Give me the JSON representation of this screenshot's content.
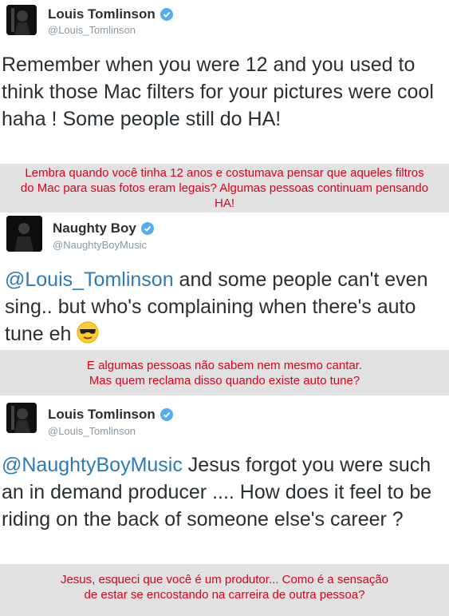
{
  "tweet1": {
    "name": "Louis Tomlinson",
    "handle": "@Louis_Tomlinson",
    "text": "Remember when you were 12 and you used to think those Mac filters for your pictures were cool haha ! Some people still do HA!",
    "translation": "Lembra quando você tinha 12 anos e costumava pensar que aqueles filtros do Mac para suas fotos eram legais? Algumas pessoas continuam pensando HA!"
  },
  "tweet2": {
    "name": "Naughty Boy",
    "handle": "@NaughtyBoyMusic",
    "mention": "@Louis_Tomlinson",
    "text": " and some people can't even sing.. but who's complaining when there's auto tune eh ",
    "emoji": "sunglasses-emoji",
    "translation_line1": "E algumas pessoas não sabem nem mesmo cantar.",
    "translation_line2": "Mas quem reclama disso quando existe auto tune?"
  },
  "tweet3": {
    "name": "Louis Tomlinson",
    "handle": "@Louis_Tomlinson",
    "mention": "@NaughtyBoyMusic",
    "text": " Jesus forgot you were such an in demand producer .... How does it feel to be riding on the back of someone else's career ?",
    "translation_line1": "Jesus, esqueci que você é um produtor...  Como é a sensação",
    "translation_line2": "de estar se encostando na carreira de outra pessoa?"
  },
  "colors": {
    "verified": "#55acee",
    "mention": "#2b7bb9",
    "translation_text": "#e0001a",
    "translation_bg": "#e1e1e1"
  }
}
